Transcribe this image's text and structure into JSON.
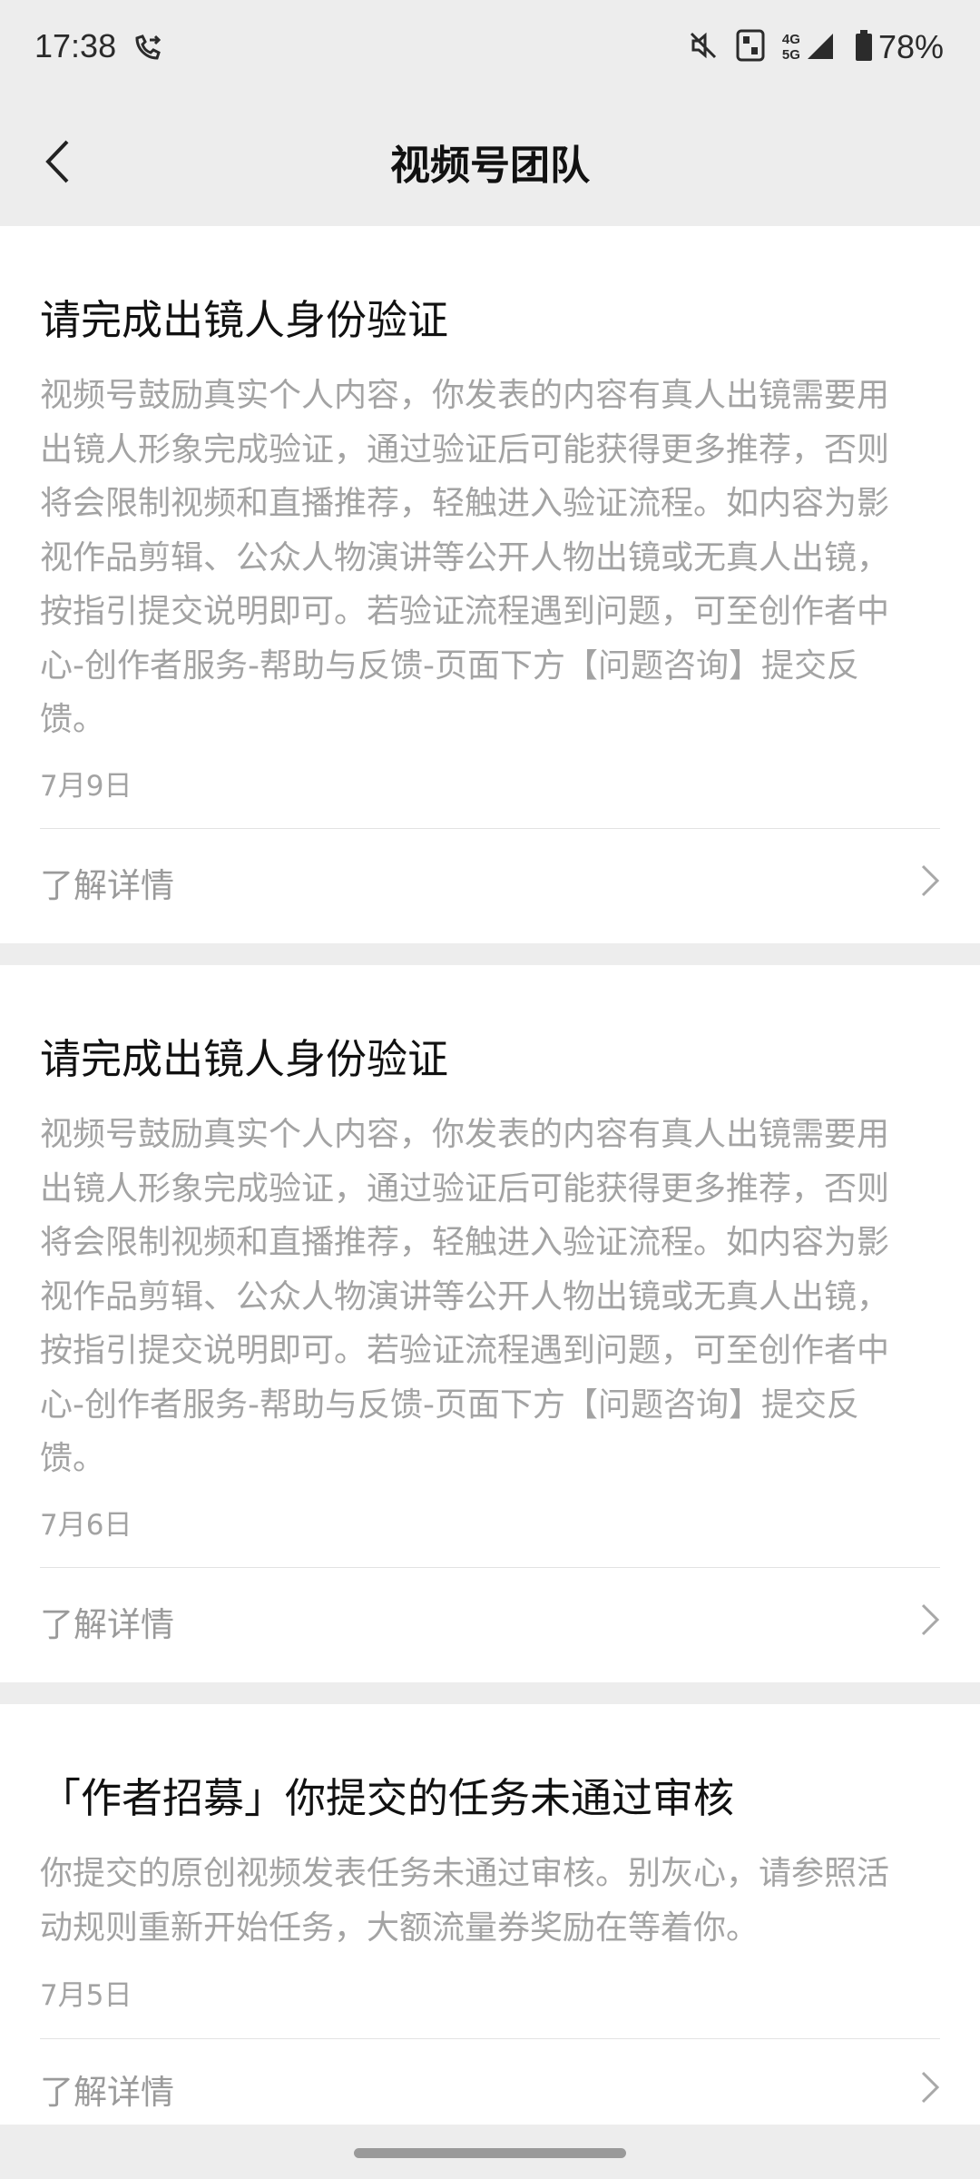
{
  "status_bar": {
    "time": "17:38",
    "battery_percent": "78%",
    "network_label_top": "4G",
    "network_label_bottom": "5G",
    "icons": [
      "call-forward-icon",
      "mute-icon",
      "nfc-icon",
      "signal-icon",
      "battery-icon"
    ]
  },
  "nav": {
    "title": "视频号团队",
    "back_icon": "chevron-left-icon"
  },
  "messages": [
    {
      "title": "请完成出镜人身份验证",
      "body_lines": [
        "视频号鼓励真实个人内容，你发表的内容有真人出镜需要用",
        "出镜人形象完成验证，通过验证后可能获得更多推荐，否则",
        "将会限制视频和直播推荐，轻触进入验证流程。如内容为影",
        "视作品剪辑、公众人物演讲等公开人物出镜或无真人出镜，",
        "按指引提交说明即可。若验证流程遇到问题，可至创作者中",
        "心-创作者服务-帮助与反馈-页面下方【问题咨询】提交反",
        "馈。"
      ],
      "date": "7月9日",
      "link_label": "了解详情"
    },
    {
      "title": "请完成出镜人身份验证",
      "body_lines": [
        "视频号鼓励真实个人内容，你发表的内容有真人出镜需要用",
        "出镜人形象完成验证，通过验证后可能获得更多推荐，否则",
        "将会限制视频和直播推荐，轻触进入验证流程。如内容为影",
        "视作品剪辑、公众人物演讲等公开人物出镜或无真人出镜，",
        "按指引提交说明即可。若验证流程遇到问题，可至创作者中",
        "心-创作者服务-帮助与反馈-页面下方【问题咨询】提交反",
        "馈。"
      ],
      "date": "7月6日",
      "link_label": "了解详情"
    },
    {
      "title": "「作者招募」你提交的任务未通过审核",
      "body_lines": [
        "你提交的原创视频发表任务未通过审核。别灰心，请参照活",
        "动规则重新开始任务，大额流量券奖励在等着你。"
      ],
      "date": "7月5日",
      "link_label": "了解详情"
    }
  ]
}
